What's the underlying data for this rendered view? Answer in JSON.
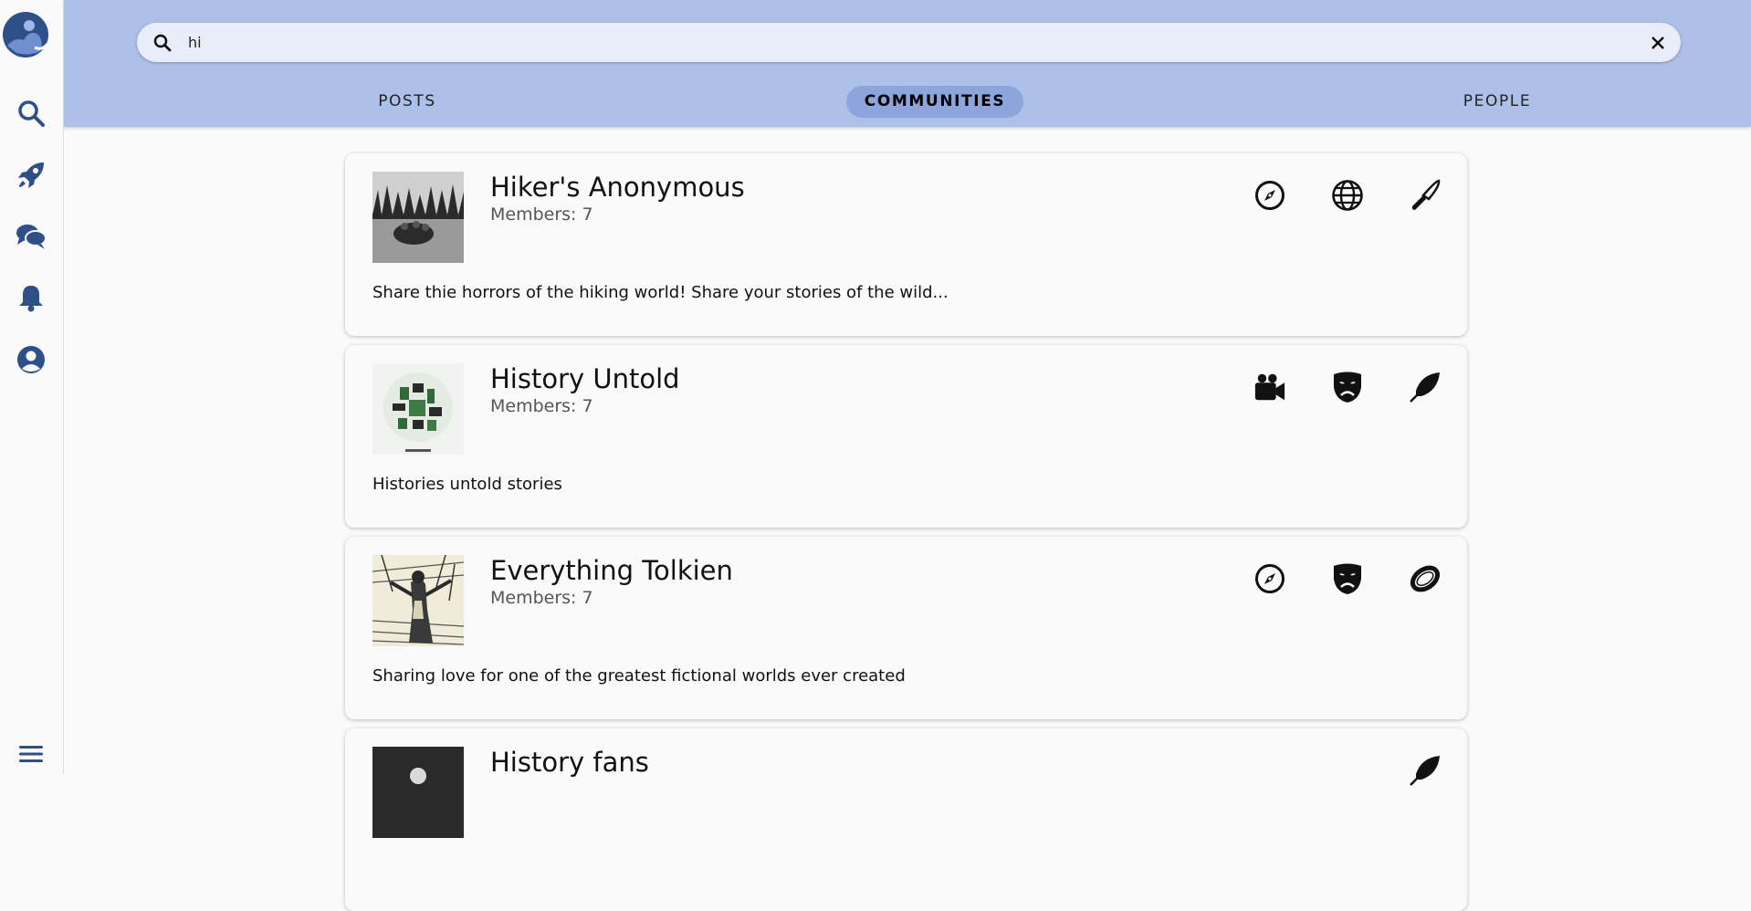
{
  "search": {
    "value": "hi",
    "placeholder": ""
  },
  "tabs": [
    {
      "label": "POSTS"
    },
    {
      "label": "COMMUNITIES"
    },
    {
      "label": "PEOPLE"
    }
  ],
  "sidebar_icons": [
    "logo-icon",
    "search-icon",
    "rocket-icon",
    "chat-icon",
    "bell-icon",
    "user-icon",
    "menu-icon"
  ],
  "colors": {
    "header": "#adc0e7",
    "accent": "#8ea5dc",
    "nav_icon": "#2f4f88"
  },
  "communities": [
    {
      "name": "Hiker's Anonymous",
      "members": "Members: 7",
      "description": "Share thie horrors of the hiking world! Share your stories of the wild...",
      "icons": [
        "compass-icon",
        "globe-icon",
        "knife-icon"
      ]
    },
    {
      "name": "History Untold",
      "members": "Members: 7",
      "description": "Histories untold stories",
      "icons": [
        "video-camera-icon",
        "theater-mask-icon",
        "feather-icon"
      ]
    },
    {
      "name": "Everything Tolkien",
      "members": "Members: 7",
      "description": "Sharing love for one of the greatest fictional worlds ever created",
      "icons": [
        "compass-icon",
        "theater-mask-icon",
        "ring-icon"
      ]
    },
    {
      "name": "History fans",
      "members": "",
      "description": "",
      "icons": [
        "feather-icon"
      ]
    }
  ]
}
